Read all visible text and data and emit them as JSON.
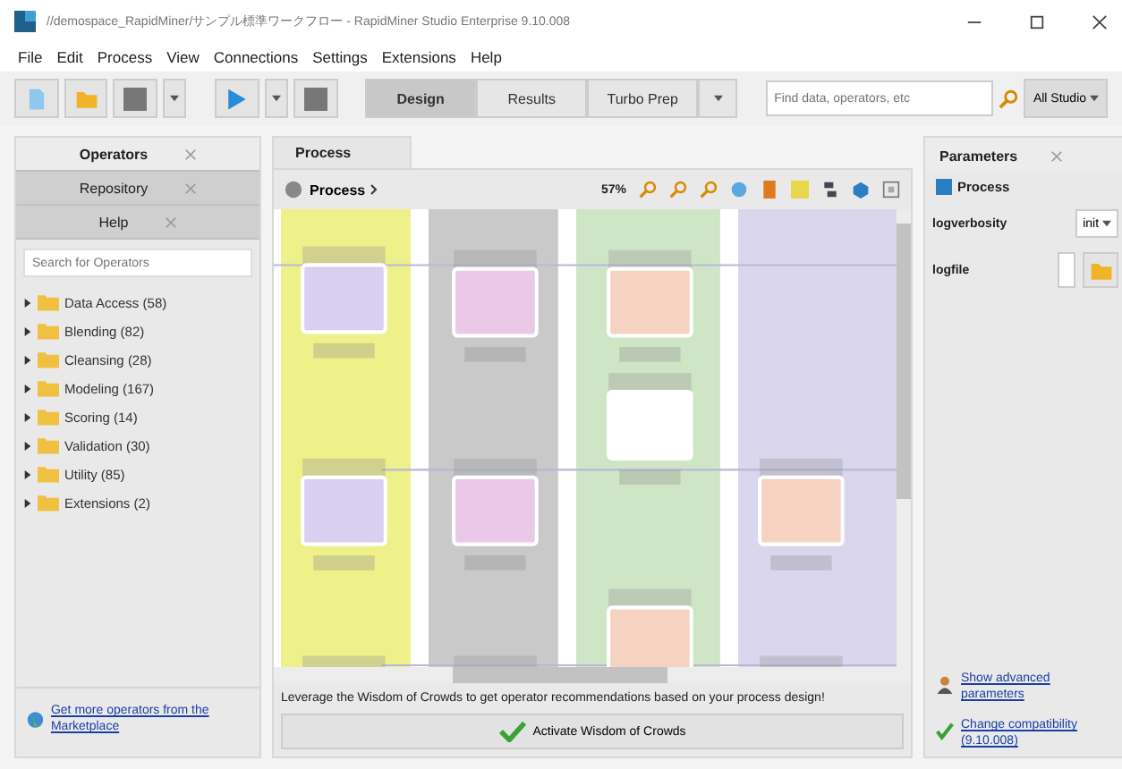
{
  "window": {
    "title": "//demospace_RapidMiner/サンプル標準ワークフロー - RapidMiner Studio Enterprise 9.10.008"
  },
  "menu": [
    "File",
    "Edit",
    "Process",
    "View",
    "Connections",
    "Settings",
    "Extensions",
    "Help"
  ],
  "perspectives": [
    {
      "label": "Design",
      "selected": true
    },
    {
      "label": "Results",
      "selected": false
    },
    {
      "label": "Turbo Prep",
      "selected": false
    }
  ],
  "global_search": {
    "placeholder": "Find data, operators, etc",
    "scope": "All Studio"
  },
  "left_panel": {
    "tabs": [
      {
        "label": "Operators",
        "selected": true
      },
      {
        "label": "Repository",
        "selected": false
      },
      {
        "label": "Help",
        "selected": false
      }
    ],
    "search": {
      "placeholder": "Search for Operators"
    },
    "tree": [
      {
        "label": "Data Access (58)",
        "expanded": false
      },
      {
        "label": "Blending (82)",
        "expanded": false
      },
      {
        "label": "Cleansing (28)",
        "expanded": false
      },
      {
        "label": "Modeling (167)",
        "expanded": false
      },
      {
        "label": "Scoring (14)",
        "expanded": false
      },
      {
        "label": "Validation (30)",
        "expanded": false
      },
      {
        "label": "Utility (85)",
        "expanded": false
      },
      {
        "label": "Extensions (2)",
        "expanded": false
      }
    ],
    "footer_link": "Get more operators from the Marketplace"
  },
  "process_panel": {
    "tab": "Process",
    "breadcrumb": "Process",
    "zoom": "57%",
    "hint": "Leverage the Wisdom of Crowds to get operator recommendations based on your process design!",
    "button": "Activate Wisdom of Crowds"
  },
  "parameters_panel": {
    "tab": "Parameters",
    "context": "Process",
    "params": [
      {
        "name": "logverbosity",
        "kind": "select",
        "value": "init"
      },
      {
        "name": "logfile",
        "kind": "file"
      }
    ],
    "links": [
      {
        "kind": "advanced",
        "label": "Show advanced parameters"
      },
      {
        "kind": "compat",
        "label": "Change compatibility (9.10.008)"
      }
    ]
  }
}
